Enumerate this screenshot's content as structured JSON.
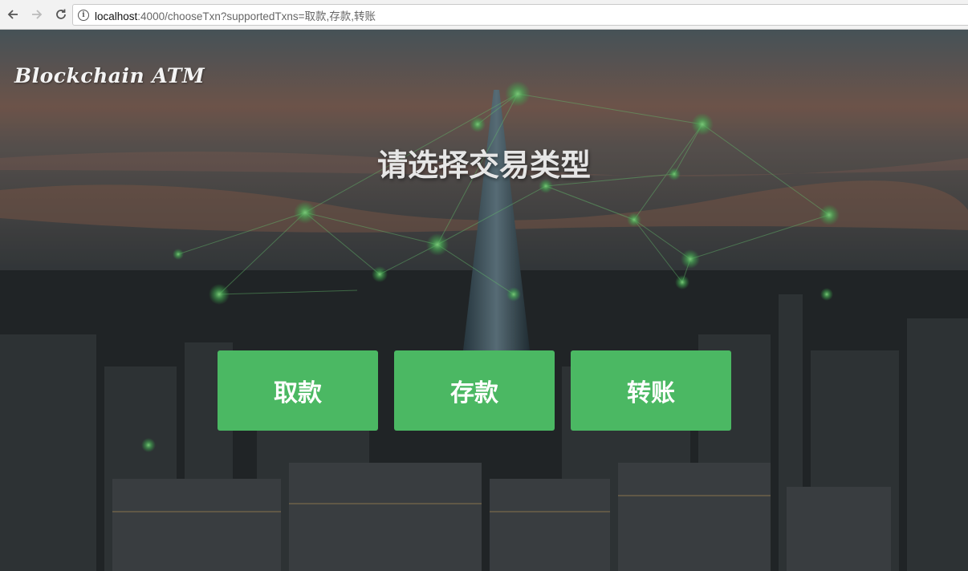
{
  "browser": {
    "url_host": "localhost",
    "url_rest": ":4000/chooseTxn?supportedTxns=取款,存款,转账"
  },
  "page": {
    "logo": "Blockchain ATM",
    "title": "请选择交易类型",
    "transactions": [
      {
        "label": "取款"
      },
      {
        "label": "存款"
      },
      {
        "label": "转账"
      }
    ]
  },
  "colors": {
    "button": "#4bb863",
    "network_glow": "#6ff27a"
  }
}
